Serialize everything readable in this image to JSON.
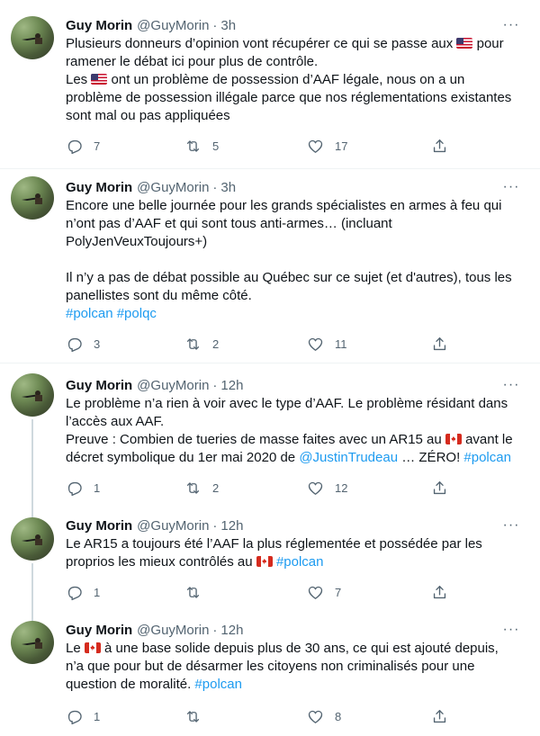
{
  "tweets": [
    {
      "name": "Guy Morin",
      "handle": "@GuyMorin",
      "time": "3h",
      "lines": [
        [
          {
            "t": "Plusieurs donneurs d’opinion vont récupérer ce qui se passe aux "
          },
          {
            "flag": "us"
          },
          {
            "t": " pour"
          }
        ],
        [
          {
            "t": "ramener le débat ici pour plus de contrôle."
          }
        ],
        [
          {
            "t": "Les "
          },
          {
            "flag": "us"
          },
          {
            "t": " ont un problème de possession d’AAF légale, nous on a un"
          }
        ],
        [
          {
            "t": "problème de possession illégale parce que nos réglementations existantes"
          }
        ],
        [
          {
            "t": "sont mal ou pas appliquées"
          }
        ]
      ],
      "replies": "7",
      "retweets": "5",
      "likes": "17"
    },
    {
      "name": "Guy Morin",
      "handle": "@GuyMorin",
      "time": "3h",
      "lines": [
        [
          {
            "t": "Encore une belle journée pour les grands spécialistes en armes à feu qui"
          }
        ],
        [
          {
            "t": "n’ont pas d’AAF et qui sont tous anti-armes… (incluant"
          }
        ],
        [
          {
            "t": "PolyJenVeuxToujours+)"
          }
        ],
        [],
        [
          {
            "t": "Il n’y a pas de débat possible au Québec sur ce sujet (et d'autres), tous les"
          }
        ],
        [
          {
            "t": "panellistes sont du même côté."
          }
        ],
        [
          {
            "link": "#polcan"
          },
          {
            "t": " "
          },
          {
            "link": "#polqc"
          }
        ]
      ],
      "replies": "3",
      "retweets": "2",
      "likes": "11"
    },
    {
      "name": "Guy Morin",
      "handle": "@GuyMorin",
      "time": "12h",
      "lines": [
        [
          {
            "t": "Le problème n’a rien à voir avec le type d’AAF. Le problème résidant dans"
          }
        ],
        [
          {
            "t": "l’accès aux AAF."
          }
        ],
        [
          {
            "t": "Preuve : Combien de tueries de masse faites avec un AR15 au "
          },
          {
            "flag": "ca"
          },
          {
            "t": " avant le"
          }
        ],
        [
          {
            "t": "décret symbolique du 1er mai 2020 de "
          },
          {
            "link": "@JustinTrudeau"
          },
          {
            "t": " … ZÉRO! "
          },
          {
            "link": "#polcan"
          }
        ]
      ],
      "replies": "1",
      "retweets": "2",
      "likes": "12"
    },
    {
      "name": "Guy Morin",
      "handle": "@GuyMorin",
      "time": "12h",
      "lines": [
        [
          {
            "t": "Le AR15 a toujours été l’AAF la plus réglementée et possédée par les"
          }
        ],
        [
          {
            "t": "proprios les mieux contrôlés au "
          },
          {
            "flag": "ca"
          },
          {
            "t": " "
          },
          {
            "link": "#polcan"
          }
        ]
      ],
      "replies": "1",
      "retweets": "",
      "likes": "7"
    },
    {
      "name": "Guy Morin",
      "handle": "@GuyMorin",
      "time": "12h",
      "lines": [
        [
          {
            "t": "Le "
          },
          {
            "flag": "ca"
          },
          {
            "t": " à une base solide depuis plus de 30 ans, ce qui est ajouté depuis,"
          }
        ],
        [
          {
            "t": "n’a que pour but de désarmer les citoyens non criminalisés pour une"
          }
        ],
        [
          {
            "t": "question de moralité. "
          },
          {
            "link": "#polcan"
          }
        ]
      ],
      "replies": "1",
      "retweets": "",
      "likes": "8"
    }
  ],
  "more_glyph": "···",
  "dot_glyph": "·",
  "icons": {
    "reply": "reply-icon",
    "retweet": "retweet-icon",
    "like": "heart-icon",
    "share": "share-icon",
    "more": "more-icon",
    "flag_us": "us-flag-icon",
    "flag_ca": "canada-flag-icon"
  },
  "colors": {
    "text": "#0f1419",
    "secondary": "#536471",
    "link": "#1d9bf0",
    "divider": "#eff3f4",
    "thread_line": "#cfd9de"
  }
}
